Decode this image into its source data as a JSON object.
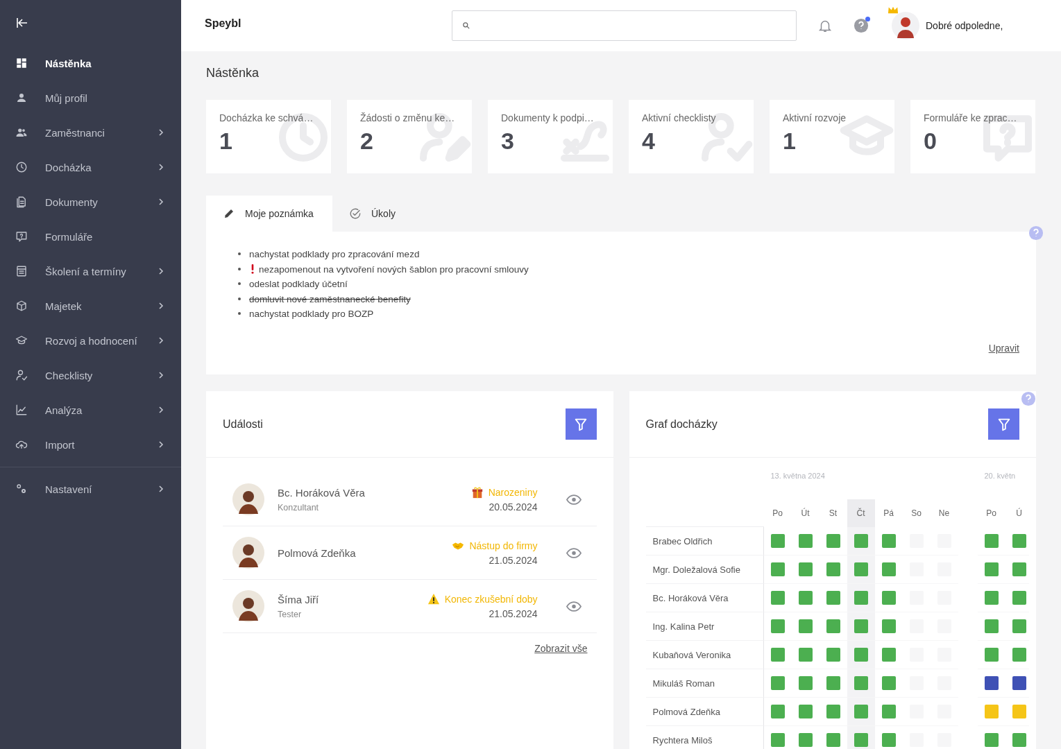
{
  "sidebar": {
    "items": [
      {
        "label": "Nástěnka",
        "kind": "dashboard",
        "selected": true,
        "submenu": false
      },
      {
        "label": "Můj profil",
        "kind": "person",
        "selected": false,
        "submenu": false
      },
      {
        "label": "Zaměstnanci",
        "kind": "people",
        "selected": false,
        "submenu": true
      },
      {
        "label": "Docházka",
        "kind": "clock",
        "selected": false,
        "submenu": true
      },
      {
        "label": "Dokumenty",
        "kind": "document",
        "selected": false,
        "submenu": true
      },
      {
        "label": "Formuláře",
        "kind": "form",
        "selected": false,
        "submenu": false
      },
      {
        "label": "Školení a termíny",
        "kind": "calendar",
        "selected": false,
        "submenu": true
      },
      {
        "label": "Majetek",
        "kind": "box",
        "selected": false,
        "submenu": true
      },
      {
        "label": "Rozvoj a hodnocení",
        "kind": "cap",
        "selected": false,
        "submenu": true
      },
      {
        "label": "Checklisty",
        "kind": "checkperson",
        "selected": false,
        "submenu": true
      },
      {
        "label": "Analýza",
        "kind": "chart",
        "selected": false,
        "submenu": true
      },
      {
        "label": "Import",
        "kind": "cloud",
        "selected": false,
        "submenu": true
      }
    ],
    "settings_item": {
      "label": "Nastavení",
      "kind": "gears",
      "selected": false,
      "submenu": true
    }
  },
  "topbar": {
    "app_name": "Speybl",
    "greeting": "Dobré odpoledne,",
    "help_badge": true
  },
  "page_title": "Nástěnka",
  "stat_cards": [
    {
      "label": "Docházka ke schvá…",
      "value": "1",
      "kind": "clock"
    },
    {
      "label": "Žádosti o změnu ke…",
      "value": "2",
      "kind": "personedit"
    },
    {
      "label": "Dokumenty k podpi…",
      "value": "3",
      "kind": "sign"
    },
    {
      "label": "Aktivní checklisty",
      "value": "4",
      "kind": "checkperson"
    },
    {
      "label": "Aktivní rozvoje",
      "value": "1",
      "kind": "cap"
    },
    {
      "label": "Formuláře ke zprac…",
      "value": "0",
      "kind": "form"
    }
  ],
  "notes": {
    "tabs": [
      {
        "label": "Moje poznámka",
        "kind": "pencil",
        "selected": true
      },
      {
        "label": "Úkoly",
        "kind": "check",
        "selected": false
      }
    ],
    "items": [
      {
        "text": "nachystat podklady pro zpracování mezd",
        "important": false,
        "done": false
      },
      {
        "text": "nezapomenout na vytvoření nových šablon pro pracovní smlouvy",
        "important": true,
        "done": false
      },
      {
        "text": "odeslat podklady účetní",
        "important": false,
        "done": false
      },
      {
        "text": "domluvit nové zaměstnanecké benefity",
        "important": false,
        "done": true
      },
      {
        "text": "nachystat podklady pro BOZP",
        "important": false,
        "done": false
      }
    ],
    "edit_link": "Upravit"
  },
  "events": {
    "title": "Události",
    "items": [
      {
        "name": "Bc. Horáková Věra",
        "role": "Konzultant",
        "event": "Narozeniny",
        "kind": "birthday",
        "date": "20.05.2024"
      },
      {
        "name": "Polmová Zdeňka",
        "event": "Nástup do firmy",
        "kind": "start",
        "date": "21.05.2024"
      },
      {
        "name": "Šíma Jiří",
        "role": "Tester",
        "event": "Konec zkušební doby",
        "kind": "probation",
        "date": "21.05.2024"
      }
    ],
    "show_all": "Zobrazit vše"
  },
  "attendance": {
    "title": "Graf docházky",
    "weeks": [
      {
        "label": "13. května 2024",
        "days": [
          {
            "label": "Po",
            "today": false
          },
          {
            "label": "Út",
            "today": false
          },
          {
            "label": "St",
            "today": false
          },
          {
            "label": "Čt",
            "today": true
          },
          {
            "label": "Pá",
            "today": false
          },
          {
            "label": "So",
            "today": false
          },
          {
            "label": "Ne",
            "today": false
          }
        ]
      },
      {
        "label": "20. květn",
        "days": [
          {
            "label": "Po",
            "today": false
          },
          {
            "label": "Ú",
            "today": false
          }
        ]
      }
    ],
    "rows": [
      {
        "name": "Brabec Oldřich",
        "cells": [
          {
            "color": "#4caf50"
          },
          {
            "color": "#4caf50"
          },
          {
            "color": "#4caf50"
          },
          {
            "color": "#4caf50"
          },
          {
            "color": "#4caf50"
          },
          {
            "color": "#f6f6f7"
          },
          {
            "color": "#f6f6f7"
          },
          {
            "color": "#4caf50"
          },
          {
            "color": "#4caf50"
          }
        ]
      },
      {
        "name": "Mgr. Doležalová Sofie",
        "cells": [
          {
            "color": "#4caf50"
          },
          {
            "color": "#4caf50"
          },
          {
            "color": "#4caf50"
          },
          {
            "color": "#4caf50"
          },
          {
            "color": "#4caf50"
          },
          {
            "color": "#f6f6f7"
          },
          {
            "color": "#f6f6f7"
          },
          {
            "color": "#4caf50"
          },
          {
            "color": "#4caf50"
          }
        ]
      },
      {
        "name": "Bc. Horáková Věra",
        "cells": [
          {
            "color": "#4caf50"
          },
          {
            "color": "#4caf50"
          },
          {
            "color": "#4caf50"
          },
          {
            "color": "#4caf50"
          },
          {
            "color": "#4caf50"
          },
          {
            "color": "#f6f6f7"
          },
          {
            "color": "#f6f6f7"
          },
          {
            "color": "#4caf50"
          },
          {
            "color": "#4caf50"
          }
        ]
      },
      {
        "name": "Ing. Kalina Petr",
        "cells": [
          {
            "color": "#4caf50"
          },
          {
            "color": "#4caf50"
          },
          {
            "color": "#4caf50"
          },
          {
            "color": "#4caf50"
          },
          {
            "color": "#4caf50"
          },
          {
            "color": "#f6f6f7"
          },
          {
            "color": "#f6f6f7"
          },
          {
            "color": "#4caf50"
          },
          {
            "color": "#4caf50"
          }
        ]
      },
      {
        "name": "Kubaňová Veronika",
        "cells": [
          {
            "color": "#4caf50"
          },
          {
            "color": "#4caf50"
          },
          {
            "color": "#4caf50"
          },
          {
            "color": "#4caf50"
          },
          {
            "color": "#4caf50"
          },
          {
            "color": "#f6f6f7"
          },
          {
            "color": "#f6f6f7"
          },
          {
            "color": "#4caf50"
          },
          {
            "color": "#4caf50"
          }
        ]
      },
      {
        "name": "Mikuláš Roman",
        "cells": [
          {
            "color": "#4caf50"
          },
          {
            "color": "#4caf50"
          },
          {
            "color": "#4caf50"
          },
          {
            "color": "#4caf50"
          },
          {
            "color": "#4caf50"
          },
          {
            "color": "#f6f6f7"
          },
          {
            "color": "#f6f6f7"
          },
          {
            "color": "#3f51b5"
          },
          {
            "color": "#3f51b5"
          }
        ]
      },
      {
        "name": "Polmová Zdeňka",
        "cells": [
          {
            "color": "#4caf50"
          },
          {
            "color": "#4caf50"
          },
          {
            "color": "#4caf50"
          },
          {
            "color": "#4caf50"
          },
          {
            "color": "#4caf50"
          },
          {
            "color": "#f6f6f7"
          },
          {
            "color": "#f6f6f7"
          },
          {
            "color": "#f5c518"
          },
          {
            "color": "#f5c518"
          }
        ]
      },
      {
        "name": "Rychtera Miloš",
        "cells": [
          {
            "color": "#4caf50"
          },
          {
            "color": "#4caf50"
          },
          {
            "color": "#4caf50"
          },
          {
            "color": "#4caf50"
          },
          {
            "color": "#4caf50"
          },
          {
            "color": "#f6f6f7"
          },
          {
            "color": "#f6f6f7"
          },
          {
            "color": "#4caf50"
          },
          {
            "color": "#4caf50"
          }
        ]
      }
    ]
  }
}
